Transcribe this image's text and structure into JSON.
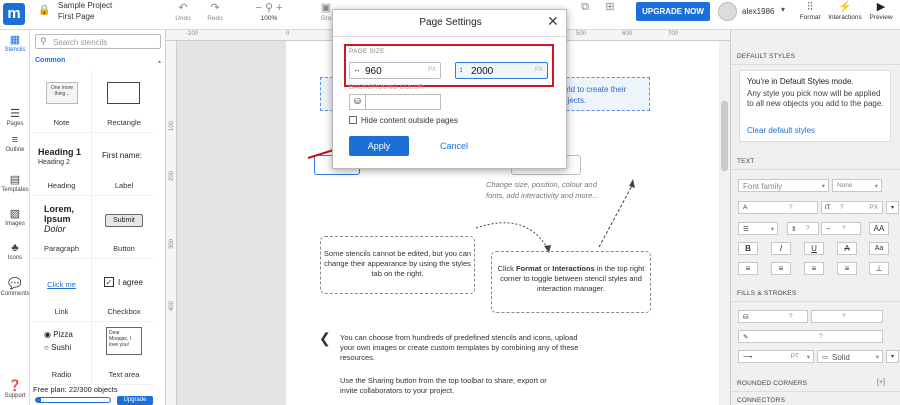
{
  "app": {
    "logo_letter": "m",
    "project_name": "Sample Project",
    "page_name": "First Page"
  },
  "toolbar": {
    "undo": "Undo",
    "redo": "Redo",
    "zoom": "100%",
    "group": "Gro",
    "upgrade": "UPGRADE NOW",
    "username": "alex1986",
    "format": "Format",
    "interactions": "Interactions",
    "preview": "Preview"
  },
  "rail": {
    "stencils": "Stencils",
    "pages": "Pages",
    "outline": "Outline",
    "templates": "Templates",
    "images": "Images",
    "icons": "Icons",
    "comments": "Comments",
    "support": "Support"
  },
  "stencils": {
    "search_placeholder": "Search stencils",
    "category": "Common",
    "items": [
      {
        "label": "Note",
        "preview": "One more thing..."
      },
      {
        "label": "Rectangle"
      },
      {
        "label": "Heading",
        "preview_h1": "Heading 1",
        "preview_h2": "Heading 2"
      },
      {
        "label": "Label",
        "preview": "First name:"
      },
      {
        "label": "Paragraph",
        "preview_l1": "Lorem,",
        "preview_l2": "Ipsum",
        "preview_l3": "Dolor"
      },
      {
        "label": "Button",
        "preview": "Submit"
      },
      {
        "label": "Link",
        "preview": "Click me"
      },
      {
        "label": "Checkbox",
        "preview": "I agree"
      },
      {
        "label": "Radio",
        "preview_1": "Pizza",
        "preview_2": "Sushi"
      },
      {
        "label": "Text area",
        "preview": "Dear Moqups, I love you!"
      }
    ],
    "plan_text": "Free plan: 22/300 objects",
    "plan_fraction": 0.0733,
    "plan_upgrade": "Upgrade"
  },
  "canvas": {
    "ruler_h": [
      "-100",
      "0",
      "100",
      "200",
      "300",
      "400",
      "500",
      "600",
      "700"
    ],
    "ruler_v": [
      "100",
      "200",
      "300",
      "400"
    ],
    "blue_note": "world to create their projects.",
    "italic_note": "Change size, position, colour and fonts, add interactivity and more...",
    "left_note": "Some stencils cannot be edited, but you can change their appearance by using the styles tab on the right.",
    "right_note_pre": "Click ",
    "right_note_format": "Format",
    "right_note_or": " or ",
    "right_note_interactions": "Interactions",
    "right_note_post": " in the top right corner to toggle between stencil styles and interaction manager.",
    "help_1": "You can choose from hundreds of predefined stencils and icons, upload your own images or create custom templates by combining any of these resources.",
    "help_2": "Use the Sharing button from the top toolbar to share, export or invite collaborators to your project."
  },
  "dialog": {
    "title": "Page Settings",
    "page_size_label": "PAGE SIZE",
    "width": "960",
    "height": "2000",
    "unit": "PX",
    "bg_color_label": "BACKGROUND COLOR",
    "hide_content": "Hide content outside pages",
    "apply": "Apply",
    "cancel": "Cancel"
  },
  "right_panel": {
    "default_styles": "DEFAULT STYLES",
    "default_title": "You're in Default Styles mode.",
    "default_body": "Any style you pick now will be applied to all new objects you add to the page.",
    "clear_link": "Clear default styles",
    "text": "TEXT",
    "font_family": "Font family",
    "font_none": "None",
    "question": "?",
    "px": "PX",
    "fills": "FILLS & STROKES",
    "pt": "PT",
    "solid": "Solid",
    "rounded": "ROUNDED CORNERS",
    "connectors": "CONNECTORS"
  },
  "colors": {
    "accent": "#1d6fd8",
    "highlight_border": "#d4141f",
    "arrow": "#c0141c"
  }
}
